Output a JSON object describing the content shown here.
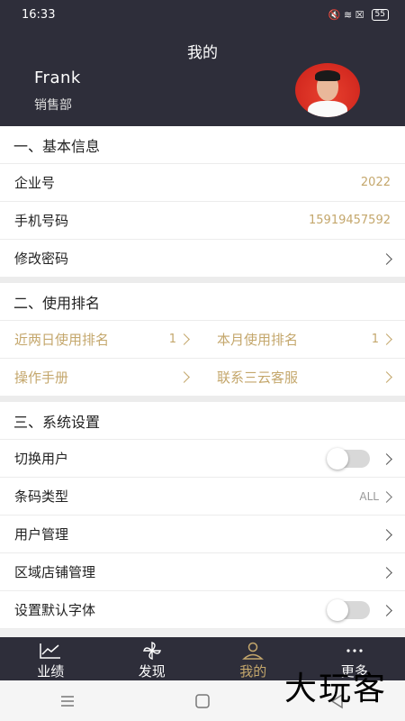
{
  "status_bar": {
    "time": "16:33",
    "icons": "🔇 ≋ ☒",
    "battery": "55"
  },
  "header": {
    "title": "我的",
    "user_name": "Frank",
    "department": "销售部"
  },
  "section1": {
    "title": "一、基本信息",
    "rows": [
      {
        "label": "企业号",
        "value": "2022"
      },
      {
        "label": "手机号码",
        "value": "15919457592"
      },
      {
        "label": "修改密码"
      }
    ]
  },
  "section2": {
    "title": "二、使用排名",
    "grid": [
      {
        "left": {
          "label": "近两日使用排名",
          "value": "1"
        },
        "right": {
          "label": "本月使用排名",
          "value": "1"
        }
      },
      {
        "left": {
          "label": "操作手册"
        },
        "right": {
          "label": "联系三云客服"
        }
      }
    ]
  },
  "section3": {
    "title": "三、系统设置",
    "rows": [
      {
        "label": "切换用户",
        "toggle": false
      },
      {
        "label": "条码类型",
        "value": "ALL"
      },
      {
        "label": "用户管理"
      },
      {
        "label": "区域店铺管理"
      },
      {
        "label": "设置默认字体",
        "toggle": false
      }
    ]
  },
  "tabbar": [
    {
      "label": "业绩",
      "icon": "chart-icon"
    },
    {
      "label": "发现",
      "icon": "pinwheel-icon"
    },
    {
      "label": "我的",
      "icon": "person-icon",
      "active": true
    },
    {
      "label": "更多",
      "icon": "dots-icon"
    }
  ],
  "watermark": "大玩客",
  "colors": {
    "dark": "#2e2e3a",
    "accent": "#c4a76c"
  }
}
